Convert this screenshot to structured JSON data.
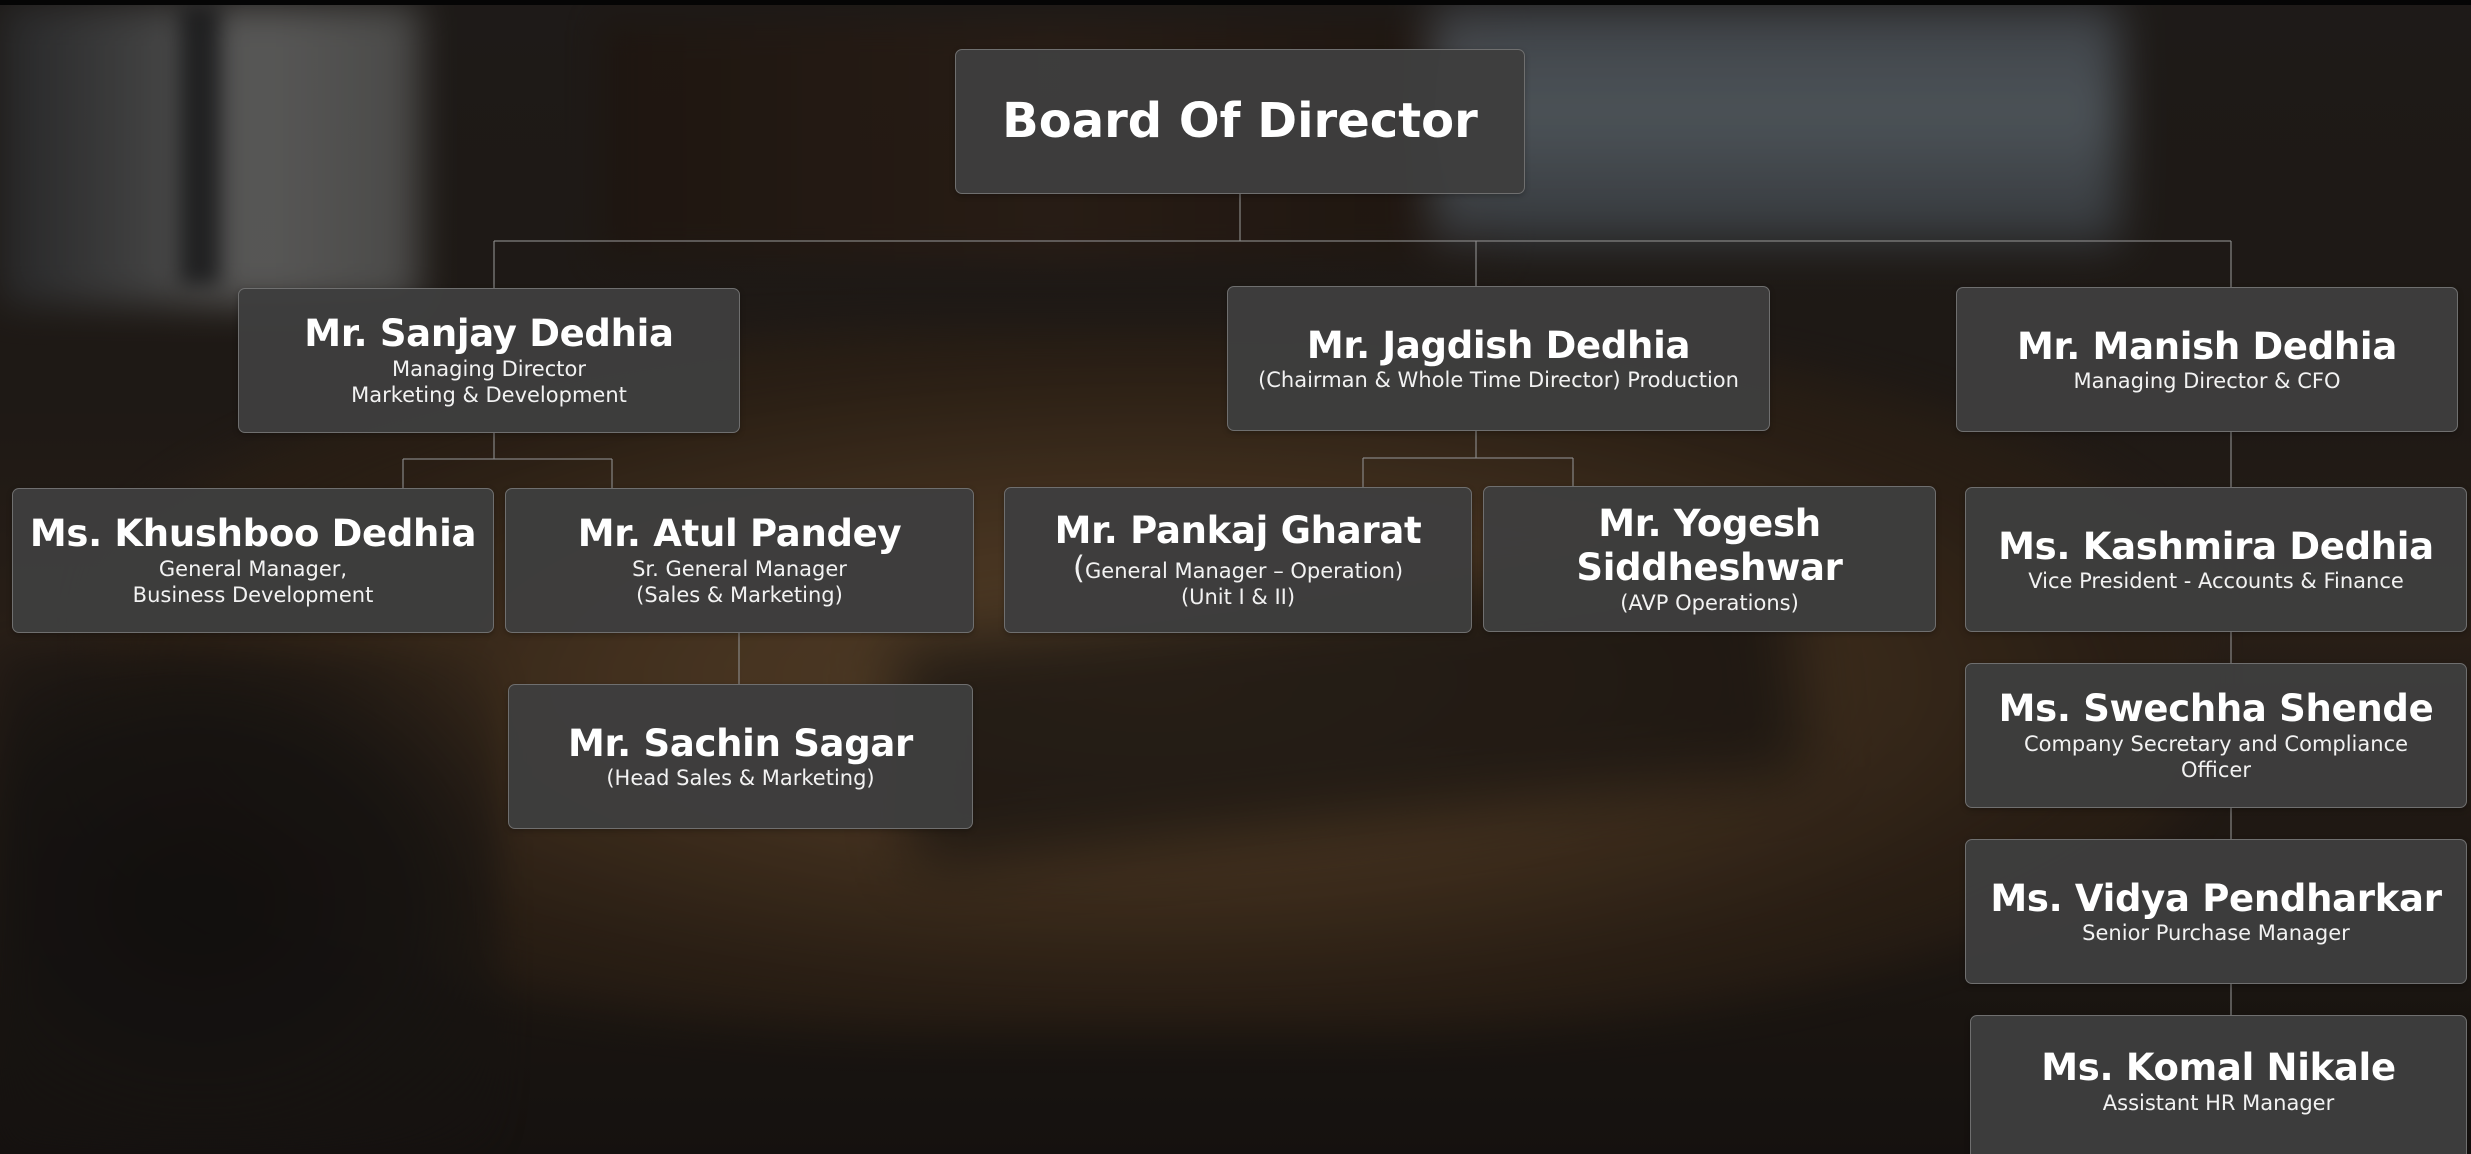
{
  "board": {
    "title": "Board Of Director"
  },
  "members": {
    "sanjay": {
      "name": "Mr. Sanjay Dedhia",
      "role_line1": "Managing Director",
      "role_line2": "Marketing & Development"
    },
    "jagdish": {
      "name": "Mr. Jagdish Dedhia",
      "role_line1": "(Chairman & Whole Time Director) Production"
    },
    "manish": {
      "name": "Mr. Manish Dedhia",
      "role_line1": "Managing Director & CFO"
    },
    "khushboo": {
      "name": "Ms. Khushboo Dedhia",
      "role_line1": "General Manager,",
      "role_line2": "Business Development"
    },
    "atul": {
      "name": "Mr. Atul Pandey",
      "role_line1": "Sr. General Manager",
      "role_line2": "(Sales & Marketing)"
    },
    "pankaj": {
      "name": "Mr. Pankaj Gharat",
      "role_paren": "(",
      "role_line1": "General Manager – Operation)",
      "role_line2": "(Unit I & II)"
    },
    "yogesh": {
      "name_line1": "Mr. Yogesh",
      "name_line2": "Siddheshwar",
      "role_line1": "(AVP Operations)"
    },
    "kashmira": {
      "name": "Ms. Kashmira Dedhia",
      "role_line1": "Vice President - Accounts & Finance"
    },
    "sachin": {
      "name": "Mr. Sachin Sagar",
      "role_line1": "(Head Sales & Marketing)"
    },
    "swechha": {
      "name": "Ms. Swechha Shende",
      "role_line1": "Company Secretary and Compliance Officer"
    },
    "vidya": {
      "name": "Ms. Vidya Pendharkar",
      "role_line1": "Senior Purchase Manager"
    },
    "komal": {
      "name": "Ms. Komal Nikale",
      "role_line1": "Assistant HR Manager"
    }
  },
  "colors": {
    "box_fill": "#3e3e3e",
    "box_border": "#6f6f6f",
    "connector": "#8c8c8c",
    "text": "#ffffff"
  }
}
